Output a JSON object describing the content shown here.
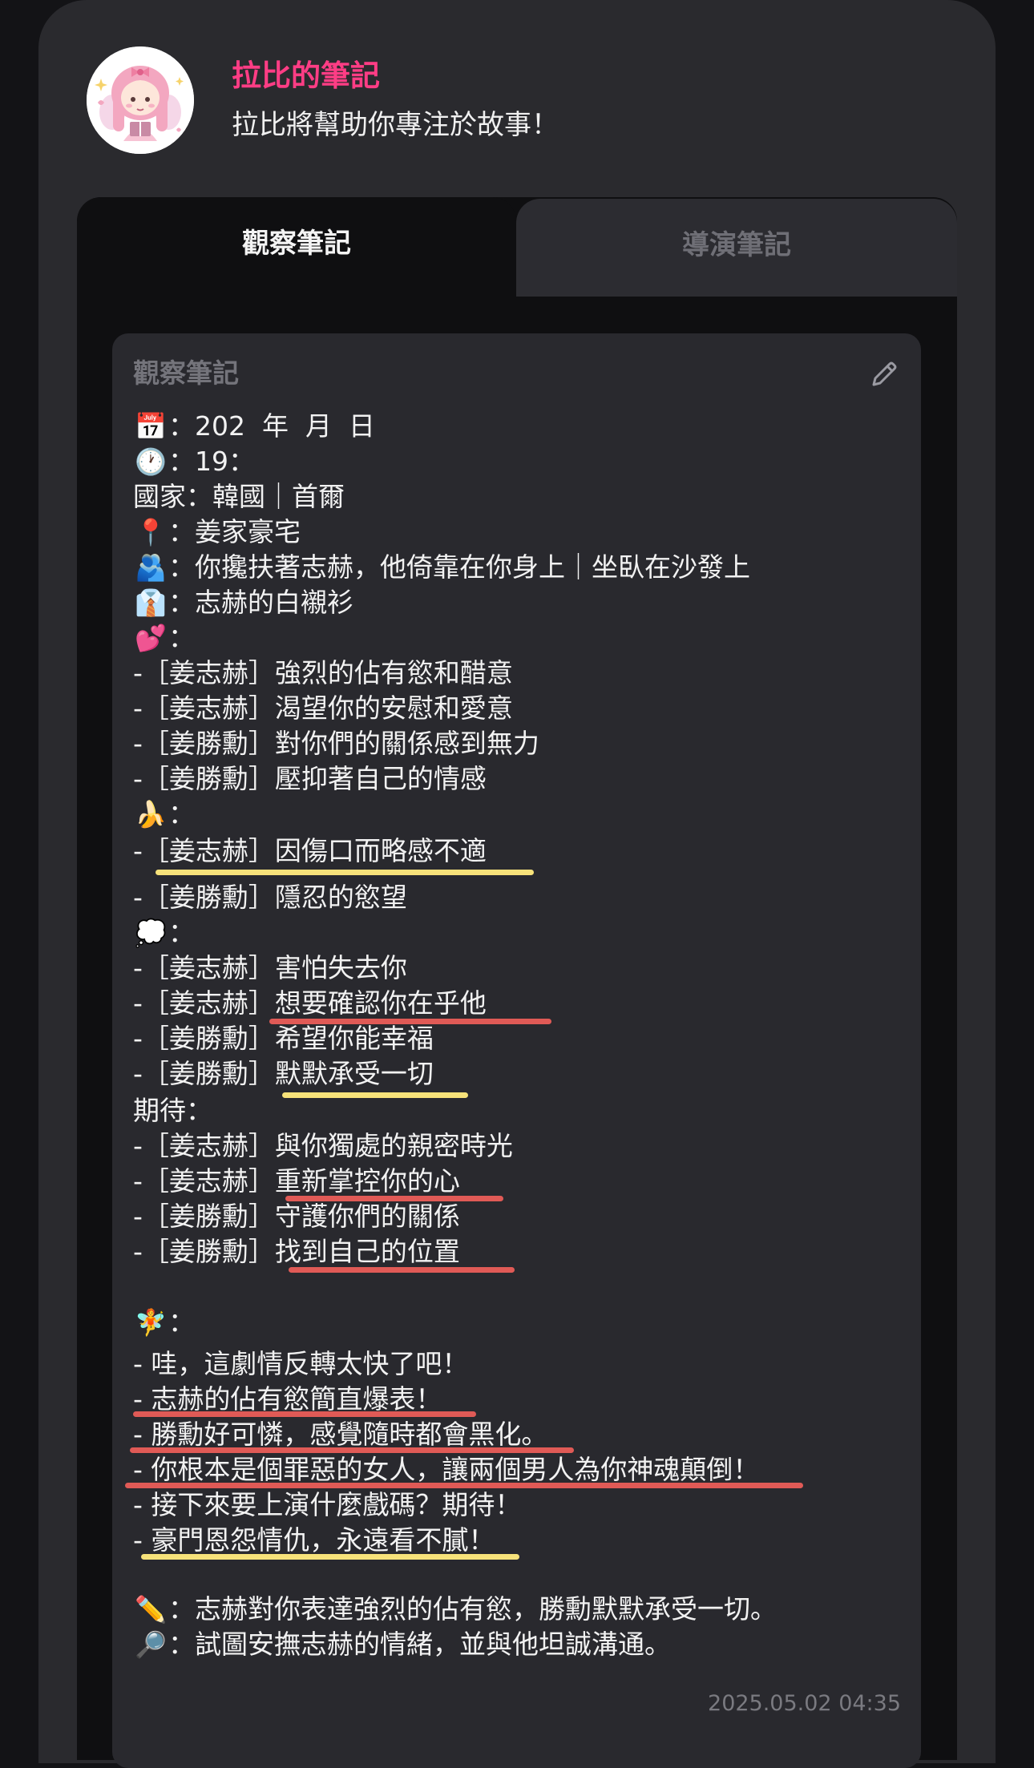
{
  "header": {
    "title": "拉比的筆記",
    "subtitle": "拉比將幫助你專注於故事！"
  },
  "tabs": [
    {
      "label": "觀察筆記",
      "active": true
    },
    {
      "label": "導演筆記",
      "active": false
    }
  ],
  "note": {
    "title": "觀察筆記",
    "timestamp": "2025.05.02 04:35",
    "lines": {
      "date": {
        "icon": "📅",
        "text": "：202  年  月  日"
      },
      "time": {
        "icon": "🕐",
        "text": "：19："
      },
      "country": {
        "text": "國家：韓國｜首爾"
      },
      "location": {
        "icon": "📍",
        "text": "：姜家豪宅"
      },
      "action": {
        "icon": "🫂",
        "text": "：你攙扶著志赫，他倚靠在你身上｜坐臥在沙發上"
      },
      "outfit": {
        "icon": "👔",
        "text": "：志赫的白襯衫"
      },
      "feelings_head": {
        "icon": "💕",
        "text": "："
      },
      "feel_1": {
        "text": "-［姜志赫］強烈的佔有慾和醋意"
      },
      "feel_2": {
        "text": "-［姜志赫］渴望你的安慰和愛意"
      },
      "feel_3": {
        "text": "-［姜勝勳］對你們的關係感到無力"
      },
      "feel_4": {
        "text": "-［姜勝勳］壓抑著自己的情感"
      },
      "body_head": {
        "icon": "🍌",
        "text": "："
      },
      "body_1": {
        "text": "-［姜志赫］因傷口而略感不適"
      },
      "body_2": {
        "text": "-［姜勝勳］隱忍的慾望"
      },
      "thought_head": {
        "icon": "💭",
        "text": "："
      },
      "thought_1": {
        "text": "-［姜志赫］害怕失去你"
      },
      "thought_2": {
        "text": "-［姜志赫］想要確認你在乎他"
      },
      "thought_3": {
        "text": "-［姜勝勳］希望你能幸福"
      },
      "thought_4": {
        "text": "-［姜勝勳］默默承受一切"
      },
      "expect_head": {
        "text": "期待："
      },
      "expect_1": {
        "text": "-［姜志赫］與你獨處的親密時光"
      },
      "expect_2": {
        "text": "-［姜志赫］重新掌控你的心"
      },
      "expect_3": {
        "text": "-［姜勝勳］守護你們的關係"
      },
      "expect_4": {
        "text": "-［姜勝勳］找到自己的位置"
      },
      "fairy_head": {
        "icon": "🧚",
        "text": "："
      },
      "fairy_1": {
        "text": "- 哇，這劇情反轉太快了吧！"
      },
      "fairy_2": {
        "text": "- 志赫的佔有慾簡直爆表！"
      },
      "fairy_3": {
        "text": "- 勝勳好可憐，感覺隨時都會黑化。"
      },
      "fairy_4": {
        "text": "- 你根本是個罪惡的女人，讓兩個男人為你神魂顛倒！"
      },
      "fairy_5": {
        "text": "- 接下來要上演什麼戲碼？期待！"
      },
      "fairy_6": {
        "text": "- 豪門恩怨情仇，永遠看不膩！"
      },
      "summary": {
        "icon": "✏️",
        "text": "：志赫對你表達強烈的佔有慾，勝勳默默承受一切。"
      },
      "next": {
        "icon": "🔎",
        "text": "：試圖安撫志赫的情緒，並與他坦誠溝通。"
      }
    }
  },
  "colors": {
    "accent": "#ff3d85",
    "highlight_yellow": "#f7e27a",
    "highlight_red": "#e05a56"
  }
}
